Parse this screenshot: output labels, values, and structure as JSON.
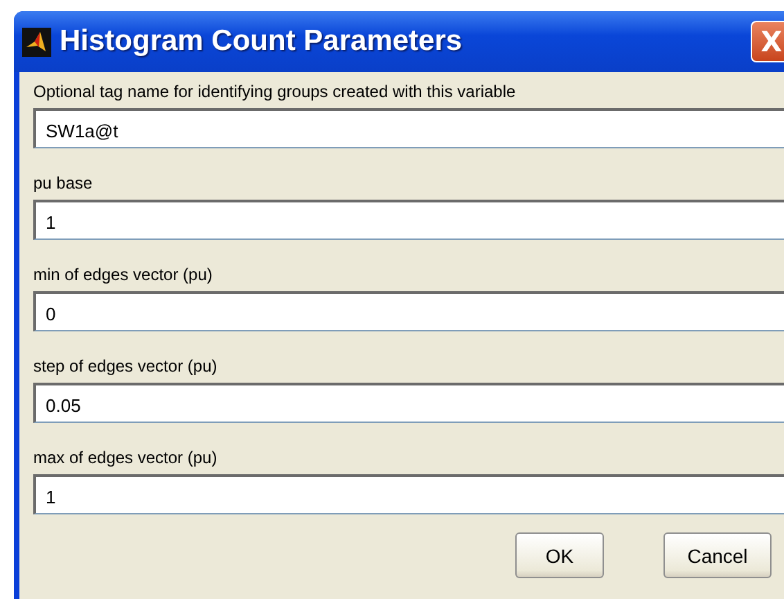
{
  "window": {
    "title": "Histogram Count Parameters",
    "close": "X"
  },
  "fields": [
    {
      "label": "Optional tag name for identifying groups created with this variable",
      "value": "SW1a@t"
    },
    {
      "label": "pu base",
      "value": "1"
    },
    {
      "label": "min of edges vector (pu)",
      "value": "0"
    },
    {
      "label": "step of edges vector (pu)",
      "value": "0.05"
    },
    {
      "label": "max of edges vector (pu)",
      "value": "1"
    }
  ],
  "buttons": [
    "OK",
    "Cancel"
  ]
}
